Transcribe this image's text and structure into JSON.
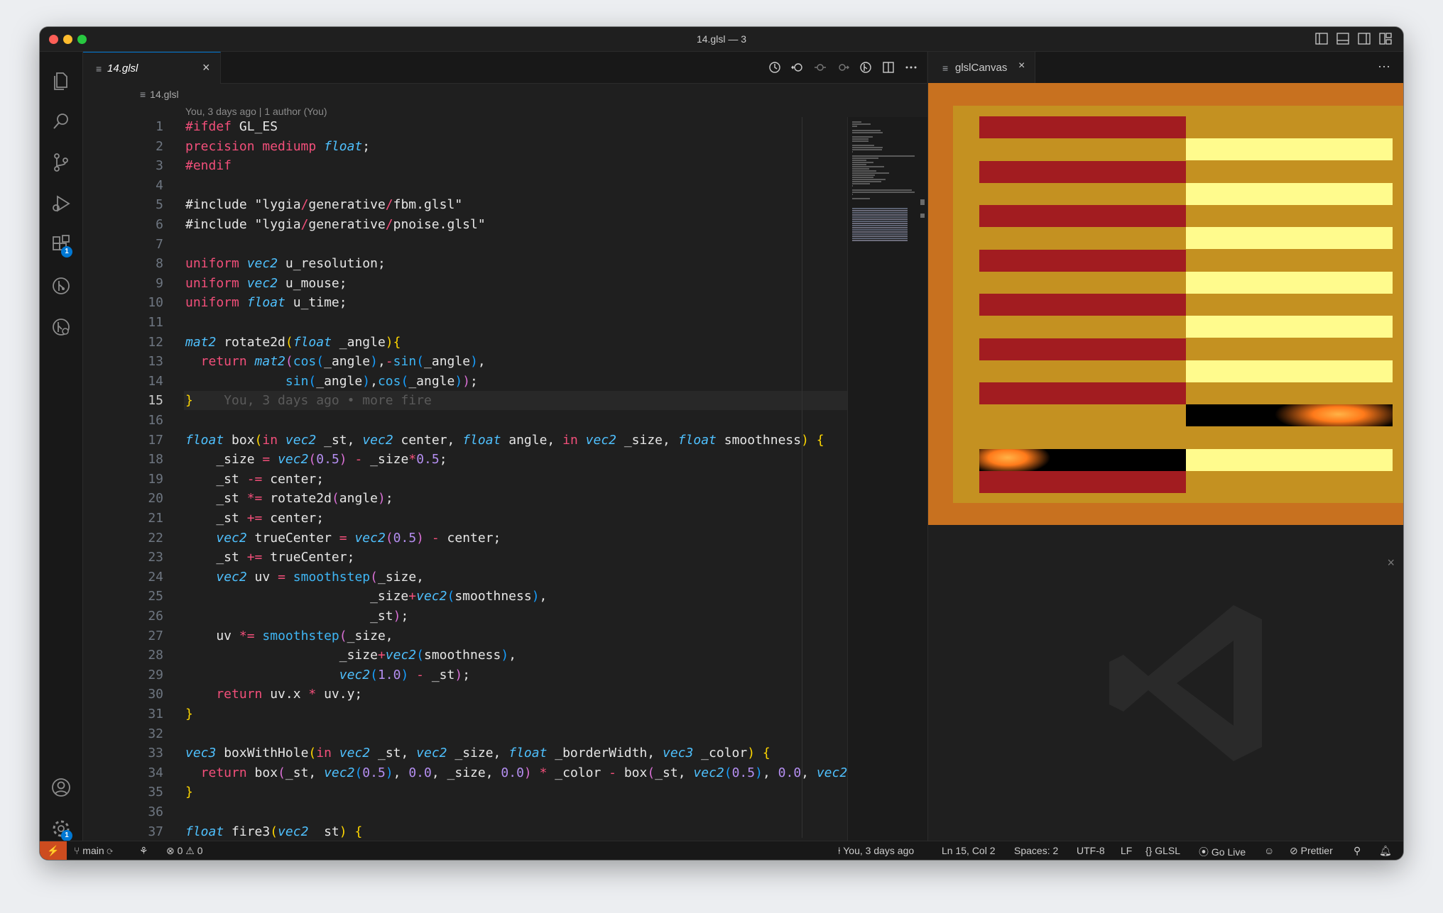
{
  "window": {
    "title": "14.glsl — 3"
  },
  "activity_bar": {
    "items": [
      {
        "name": "explorer-icon"
      },
      {
        "name": "search-icon"
      },
      {
        "name": "source-control-icon"
      },
      {
        "name": "run-debug-icon"
      },
      {
        "name": "extensions-icon",
        "badge": "1"
      },
      {
        "name": "git-graph-icon"
      },
      {
        "name": "remote-explorer-icon"
      }
    ],
    "account_icon": "account-icon",
    "settings_icon": "gear-icon",
    "settings_badge": "1"
  },
  "editor": {
    "tab": {
      "label": "14.glsl",
      "icon": "file-lines-icon"
    },
    "breadcrumb": "14.glsl",
    "blame_header": "You, 3 days ago | 1 author (You)",
    "current_line": 15,
    "inline_blame": "You, 3 days ago • more fire",
    "lines": [
      [
        {
          "t": "#ifdef",
          "c": "kw"
        },
        {
          "t": " GL_ES",
          "c": "fg"
        }
      ],
      [
        {
          "t": "precision mediump",
          "c": "kw"
        },
        {
          "t": " ",
          "c": "fg"
        },
        {
          "t": "float",
          "c": "ty"
        },
        {
          "t": ";",
          "c": "fg"
        }
      ],
      [
        {
          "t": "#endif",
          "c": "kw"
        }
      ],
      [],
      [
        {
          "t": "#include \"lygia",
          "c": "fg"
        },
        {
          "t": "/",
          "c": "kw"
        },
        {
          "t": "generative",
          "c": "fg"
        },
        {
          "t": "/",
          "c": "kw"
        },
        {
          "t": "fbm.glsl\"",
          "c": "fg"
        }
      ],
      [
        {
          "t": "#include \"lygia",
          "c": "fg"
        },
        {
          "t": "/",
          "c": "kw"
        },
        {
          "t": "generative",
          "c": "fg"
        },
        {
          "t": "/",
          "c": "kw"
        },
        {
          "t": "pnoise.glsl\"",
          "c": "fg"
        }
      ],
      [],
      [
        {
          "t": "uniform",
          "c": "kw"
        },
        {
          "t": " ",
          "c": "fg"
        },
        {
          "t": "vec2",
          "c": "ty"
        },
        {
          "t": " u_resolution;",
          "c": "fg"
        }
      ],
      [
        {
          "t": "uniform",
          "c": "kw"
        },
        {
          "t": " ",
          "c": "fg"
        },
        {
          "t": "vec2",
          "c": "ty"
        },
        {
          "t": " u_mouse;",
          "c": "fg"
        }
      ],
      [
        {
          "t": "uniform",
          "c": "kw"
        },
        {
          "t": " ",
          "c": "fg"
        },
        {
          "t": "float",
          "c": "ty"
        },
        {
          "t": " u_time;",
          "c": "fg"
        }
      ],
      [],
      [
        {
          "t": "mat2",
          "c": "ty"
        },
        {
          "t": " rotate2d",
          "c": "fg"
        },
        {
          "t": "(",
          "c": "br"
        },
        {
          "t": "float",
          "c": "ty"
        },
        {
          "t": " _angle",
          "c": "fg"
        },
        {
          "t": "){",
          "c": "br"
        }
      ],
      [
        {
          "t": "  return ",
          "c": "kw"
        },
        {
          "t": "mat2",
          "c": "ty"
        },
        {
          "t": "(",
          "c": "br2"
        },
        {
          "t": "cos",
          "c": "fn"
        },
        {
          "t": "(",
          "c": "br3"
        },
        {
          "t": "_angle",
          "c": "fg"
        },
        {
          "t": ")",
          "c": "br3"
        },
        {
          "t": ",",
          "c": "fg"
        },
        {
          "t": "-",
          "c": "kw"
        },
        {
          "t": "sin",
          "c": "fn"
        },
        {
          "t": "(",
          "c": "br3"
        },
        {
          "t": "_angle",
          "c": "fg"
        },
        {
          "t": ")",
          "c": "br3"
        },
        {
          "t": ",",
          "c": "fg"
        }
      ],
      [
        {
          "t": "             ",
          "c": "fg"
        },
        {
          "t": "sin",
          "c": "fn"
        },
        {
          "t": "(",
          "c": "br3"
        },
        {
          "t": "_angle",
          "c": "fg"
        },
        {
          "t": ")",
          "c": "br3"
        },
        {
          "t": ",",
          "c": "fg"
        },
        {
          "t": "cos",
          "c": "fn"
        },
        {
          "t": "(",
          "c": "br3"
        },
        {
          "t": "_angle",
          "c": "fg"
        },
        {
          "t": ")",
          "c": "br3"
        },
        {
          "t": ")",
          "c": "br2"
        },
        {
          "t": ";",
          "c": "fg"
        }
      ],
      [
        {
          "t": "}",
          "c": "br"
        }
      ],
      [],
      [
        {
          "t": "float",
          "c": "ty"
        },
        {
          "t": " box",
          "c": "fg"
        },
        {
          "t": "(",
          "c": "br"
        },
        {
          "t": "in",
          "c": "kw"
        },
        {
          "t": " ",
          "c": "fg"
        },
        {
          "t": "vec2",
          "c": "ty"
        },
        {
          "t": " _st, ",
          "c": "fg"
        },
        {
          "t": "vec2",
          "c": "ty"
        },
        {
          "t": " center, ",
          "c": "fg"
        },
        {
          "t": "float",
          "c": "ty"
        },
        {
          "t": " angle, ",
          "c": "fg"
        },
        {
          "t": "in",
          "c": "kw"
        },
        {
          "t": " ",
          "c": "fg"
        },
        {
          "t": "vec2",
          "c": "ty"
        },
        {
          "t": " _size, ",
          "c": "fg"
        },
        {
          "t": "float",
          "c": "ty"
        },
        {
          "t": " smoothness",
          "c": "fg"
        },
        {
          "t": ")",
          "c": "br"
        },
        {
          "t": " ",
          "c": "fg"
        },
        {
          "t": "{",
          "c": "br"
        }
      ],
      [
        {
          "t": "    _size ",
          "c": "fg"
        },
        {
          "t": "=",
          "c": "kw"
        },
        {
          "t": " ",
          "c": "fg"
        },
        {
          "t": "vec2",
          "c": "ty"
        },
        {
          "t": "(",
          "c": "br2"
        },
        {
          "t": "0.5",
          "c": "nu"
        },
        {
          "t": ")",
          "c": "br2"
        },
        {
          "t": " ",
          "c": "fg"
        },
        {
          "t": "-",
          "c": "kw"
        },
        {
          "t": " _size",
          "c": "fg"
        },
        {
          "t": "*",
          "c": "kw"
        },
        {
          "t": "0.5",
          "c": "nu"
        },
        {
          "t": ";",
          "c": "fg"
        }
      ],
      [
        {
          "t": "    _st ",
          "c": "fg"
        },
        {
          "t": "-=",
          "c": "kw"
        },
        {
          "t": " center;",
          "c": "fg"
        }
      ],
      [
        {
          "t": "    _st ",
          "c": "fg"
        },
        {
          "t": "*=",
          "c": "kw"
        },
        {
          "t": " rotate2d",
          "c": "fg"
        },
        {
          "t": "(",
          "c": "br2"
        },
        {
          "t": "angle",
          "c": "fg"
        },
        {
          "t": ")",
          "c": "br2"
        },
        {
          "t": ";",
          "c": "fg"
        }
      ],
      [
        {
          "t": "    _st ",
          "c": "fg"
        },
        {
          "t": "+=",
          "c": "kw"
        },
        {
          "t": " center;",
          "c": "fg"
        }
      ],
      [
        {
          "t": "    ",
          "c": "fg"
        },
        {
          "t": "vec2",
          "c": "ty"
        },
        {
          "t": " trueCenter ",
          "c": "fg"
        },
        {
          "t": "=",
          "c": "kw"
        },
        {
          "t": " ",
          "c": "fg"
        },
        {
          "t": "vec2",
          "c": "ty"
        },
        {
          "t": "(",
          "c": "br2"
        },
        {
          "t": "0.5",
          "c": "nu"
        },
        {
          "t": ")",
          "c": "br2"
        },
        {
          "t": " ",
          "c": "fg"
        },
        {
          "t": "-",
          "c": "kw"
        },
        {
          "t": " center;",
          "c": "fg"
        }
      ],
      [
        {
          "t": "    _st ",
          "c": "fg"
        },
        {
          "t": "+=",
          "c": "kw"
        },
        {
          "t": " trueCenter;",
          "c": "fg"
        }
      ],
      [
        {
          "t": "    ",
          "c": "fg"
        },
        {
          "t": "vec2",
          "c": "ty"
        },
        {
          "t": " uv ",
          "c": "fg"
        },
        {
          "t": "=",
          "c": "kw"
        },
        {
          "t": " ",
          "c": "fg"
        },
        {
          "t": "smoothstep",
          "c": "fn"
        },
        {
          "t": "(",
          "c": "br2"
        },
        {
          "t": "_size,",
          "c": "fg"
        }
      ],
      [
        {
          "t": "                        _size",
          "c": "fg"
        },
        {
          "t": "+",
          "c": "kw"
        },
        {
          "t": "vec2",
          "c": "ty"
        },
        {
          "t": "(",
          "c": "br3"
        },
        {
          "t": "smoothness",
          "c": "fg"
        },
        {
          "t": ")",
          "c": "br3"
        },
        {
          "t": ",",
          "c": "fg"
        }
      ],
      [
        {
          "t": "                        _st",
          "c": "fg"
        },
        {
          "t": ")",
          "c": "br2"
        },
        {
          "t": ";",
          "c": "fg"
        }
      ],
      [
        {
          "t": "    uv ",
          "c": "fg"
        },
        {
          "t": "*=",
          "c": "kw"
        },
        {
          "t": " ",
          "c": "fg"
        },
        {
          "t": "smoothstep",
          "c": "fn"
        },
        {
          "t": "(",
          "c": "br2"
        },
        {
          "t": "_size,",
          "c": "fg"
        }
      ],
      [
        {
          "t": "                    _size",
          "c": "fg"
        },
        {
          "t": "+",
          "c": "kw"
        },
        {
          "t": "vec2",
          "c": "ty"
        },
        {
          "t": "(",
          "c": "br3"
        },
        {
          "t": "smoothness",
          "c": "fg"
        },
        {
          "t": ")",
          "c": "br3"
        },
        {
          "t": ",",
          "c": "fg"
        }
      ],
      [
        {
          "t": "                    ",
          "c": "fg"
        },
        {
          "t": "vec2",
          "c": "ty"
        },
        {
          "t": "(",
          "c": "br3"
        },
        {
          "t": "1.0",
          "c": "nu"
        },
        {
          "t": ")",
          "c": "br3"
        },
        {
          "t": " ",
          "c": "fg"
        },
        {
          "t": "-",
          "c": "kw"
        },
        {
          "t": " _st",
          "c": "fg"
        },
        {
          "t": ")",
          "c": "br2"
        },
        {
          "t": ";",
          "c": "fg"
        }
      ],
      [
        {
          "t": "    return",
          "c": "kw"
        },
        {
          "t": " uv.x ",
          "c": "fg"
        },
        {
          "t": "*",
          "c": "kw"
        },
        {
          "t": " uv.y;",
          "c": "fg"
        }
      ],
      [
        {
          "t": "}",
          "c": "br"
        }
      ],
      [],
      [
        {
          "t": "vec3",
          "c": "ty"
        },
        {
          "t": " boxWithHole",
          "c": "fg"
        },
        {
          "t": "(",
          "c": "br"
        },
        {
          "t": "in",
          "c": "kw"
        },
        {
          "t": " ",
          "c": "fg"
        },
        {
          "t": "vec2",
          "c": "ty"
        },
        {
          "t": " _st, ",
          "c": "fg"
        },
        {
          "t": "vec2",
          "c": "ty"
        },
        {
          "t": " _size, ",
          "c": "fg"
        },
        {
          "t": "float",
          "c": "ty"
        },
        {
          "t": " _borderWidth, ",
          "c": "fg"
        },
        {
          "t": "vec3",
          "c": "ty"
        },
        {
          "t": " _color",
          "c": "fg"
        },
        {
          "t": ")",
          "c": "br"
        },
        {
          "t": " ",
          "c": "fg"
        },
        {
          "t": "{",
          "c": "br"
        }
      ],
      [
        {
          "t": "  return",
          "c": "kw"
        },
        {
          "t": " box",
          "c": "fg"
        },
        {
          "t": "(",
          "c": "br2"
        },
        {
          "t": "_st, ",
          "c": "fg"
        },
        {
          "t": "vec2",
          "c": "ty"
        },
        {
          "t": "(",
          "c": "br3"
        },
        {
          "t": "0.5",
          "c": "nu"
        },
        {
          "t": ")",
          "c": "br3"
        },
        {
          "t": ", ",
          "c": "fg"
        },
        {
          "t": "0.0",
          "c": "nu"
        },
        {
          "t": ", _size, ",
          "c": "fg"
        },
        {
          "t": "0.0",
          "c": "nu"
        },
        {
          "t": ")",
          "c": "br2"
        },
        {
          "t": " ",
          "c": "fg"
        },
        {
          "t": "*",
          "c": "kw"
        },
        {
          "t": " _color ",
          "c": "fg"
        },
        {
          "t": "-",
          "c": "kw"
        },
        {
          "t": " box",
          "c": "fg"
        },
        {
          "t": "(",
          "c": "br2"
        },
        {
          "t": "_st, ",
          "c": "fg"
        },
        {
          "t": "vec2",
          "c": "ty"
        },
        {
          "t": "(",
          "c": "br3"
        },
        {
          "t": "0.5",
          "c": "nu"
        },
        {
          "t": ")",
          "c": "br3"
        },
        {
          "t": ", ",
          "c": "fg"
        },
        {
          "t": "0.0",
          "c": "nu"
        },
        {
          "t": ", ",
          "c": "fg"
        },
        {
          "t": "vec2",
          "c": "ty"
        }
      ],
      [
        {
          "t": "}",
          "c": "br"
        }
      ],
      [],
      [
        {
          "t": "float",
          "c": "ty"
        },
        {
          "t": " fire3",
          "c": "fg"
        },
        {
          "t": "(",
          "c": "br"
        },
        {
          "t": "vec2",
          "c": "ty"
        },
        {
          "t": " _st",
          "c": "fg"
        },
        {
          "t": ")",
          "c": "br"
        },
        {
          "t": " ",
          "c": "fg"
        },
        {
          "t": "{",
          "c": "br"
        }
      ]
    ]
  },
  "colors": {
    "kw": "#f24f7a",
    "ty": "#4fc1ff",
    "fn": "#3fb6f5",
    "nu": "#b48ef0",
    "fg": "#e6e6e6",
    "br": "#ffd700",
    "br2": "#da70d6",
    "br3": "#179fff",
    "accent": "#0078d4",
    "remote_bg": "#cd4c1f"
  },
  "panel": {
    "tab": {
      "label": "glslCanvas",
      "icon": "file-lines-icon"
    },
    "canvas": {
      "outer_color": "#c8711f",
      "inner_color": "#c49121",
      "left_stripe_color": "#a21c20",
      "right_stripe_color": "#fffb8d"
    }
  },
  "status_bar": {
    "branch": "main",
    "errors": "0",
    "warnings": "0",
    "blame": "You, 3 days ago",
    "position": "Ln 15, Col 2",
    "spaces": "Spaces: 2",
    "encoding": "UTF-8",
    "eol": "LF",
    "language": "GLSL",
    "go_live": "Go Live",
    "prettier": "Prettier"
  }
}
